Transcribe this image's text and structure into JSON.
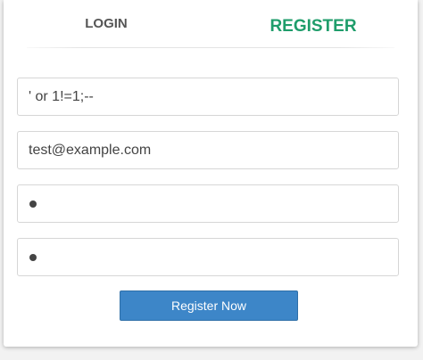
{
  "tabs": {
    "login_label": "LOGIN",
    "register_label": "REGISTER",
    "active": "register"
  },
  "form": {
    "username_value": "' or 1!=1;--",
    "email_value": "test@example.com",
    "password_masked_length": 1,
    "confirm_masked_length": 1,
    "submit_label": "Register Now"
  },
  "colors": {
    "active_tab": "#1f9d6b",
    "inactive_tab": "#555555",
    "button_bg": "#3d86c8"
  }
}
